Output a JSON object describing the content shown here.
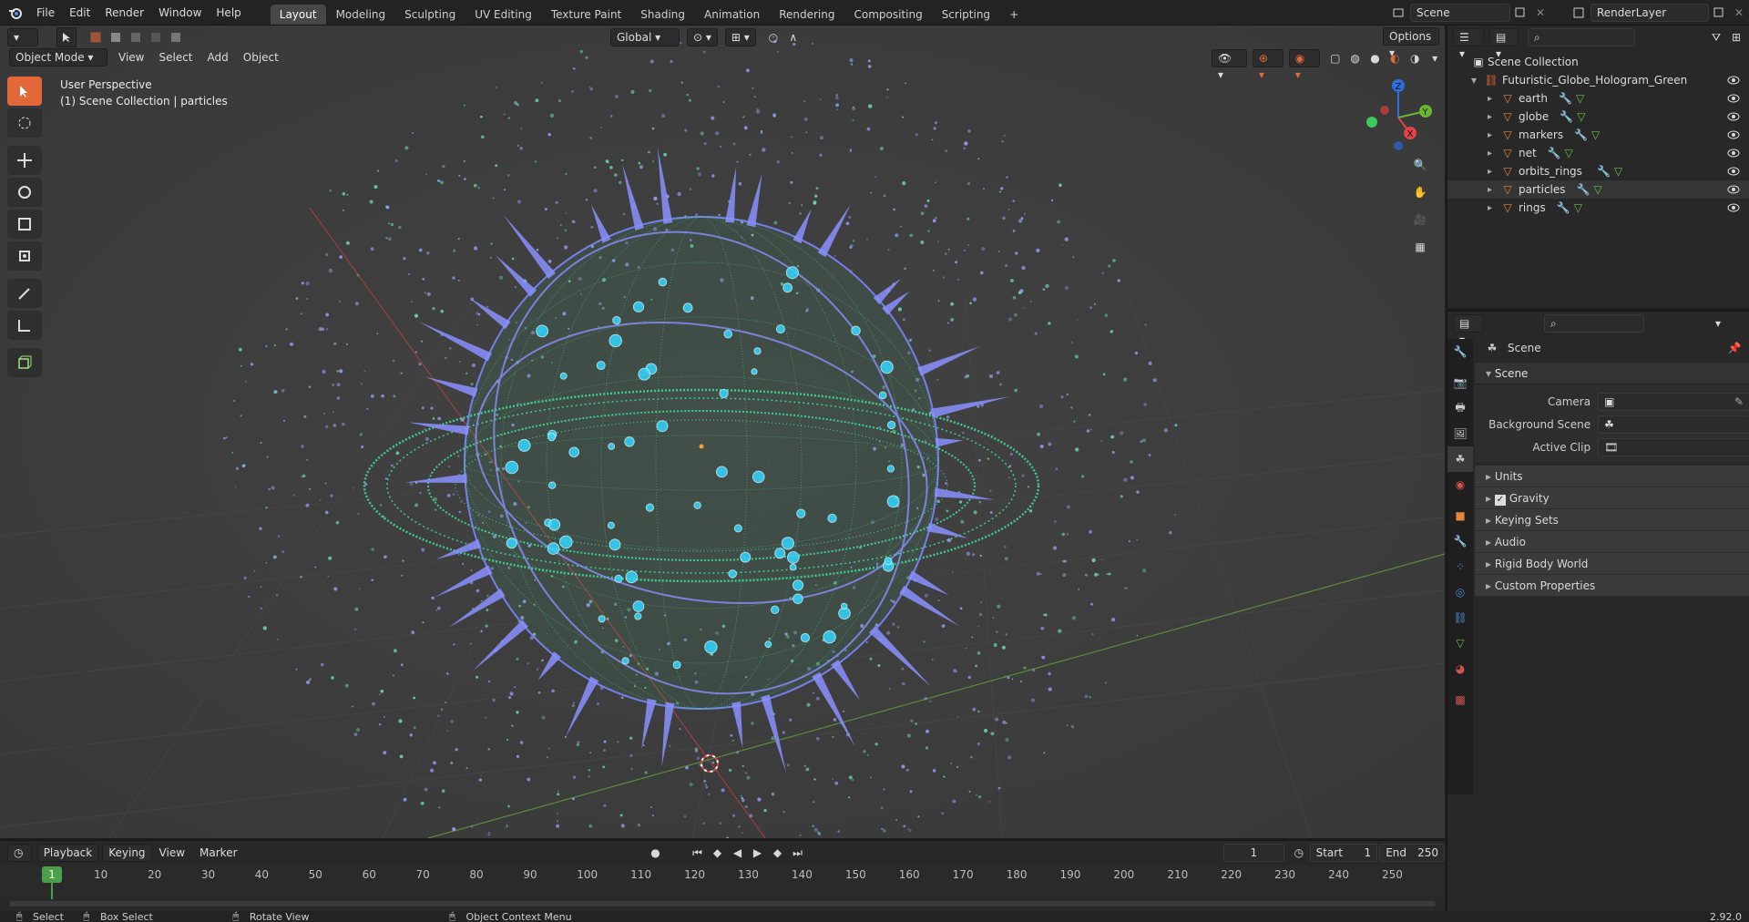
{
  "topbar": {
    "menus": [
      "File",
      "Edit",
      "Render",
      "Window",
      "Help"
    ],
    "workspaces": [
      "Layout",
      "Modeling",
      "Sculpting",
      "UV Editing",
      "Texture Paint",
      "Shading",
      "Animation",
      "Rendering",
      "Compositing",
      "Scripting"
    ],
    "active_workspace": "Layout",
    "add_tab": "+",
    "scene_name": "Scene",
    "view_layer": "RenderLayer"
  },
  "viewport": {
    "mode": "Object Mode",
    "menus": [
      "View",
      "Select",
      "Add",
      "Object"
    ],
    "orientation": "Global",
    "options_label": "Options",
    "overlay_title": "User Perspective",
    "overlay_subtitle": "(1) Scene Collection | particles",
    "gizmo": {
      "x": "X",
      "y": "Y",
      "z": "Z"
    }
  },
  "outliner": {
    "root": "Scene Collection",
    "collection": "Futuristic_Globe_Hologram_Green",
    "items": [
      {
        "name": "earth"
      },
      {
        "name": "globe"
      },
      {
        "name": "markers"
      },
      {
        "name": "net"
      },
      {
        "name": "orbits_rings"
      },
      {
        "name": "particles"
      },
      {
        "name": "rings"
      }
    ]
  },
  "properties": {
    "context": "Scene",
    "panel": "Scene",
    "fields": [
      {
        "label": "Camera",
        "value": ""
      },
      {
        "label": "Background Scene",
        "value": ""
      },
      {
        "label": "Active Clip",
        "value": ""
      }
    ],
    "subpanels": [
      "Units",
      "Gravity",
      "Keying Sets",
      "Audio",
      "Rigid Body World",
      "Custom Properties"
    ],
    "gravity_checked": true
  },
  "timeline": {
    "menus": [
      "Playback",
      "Keying",
      "View",
      "Marker"
    ],
    "current_frame": "1",
    "start_label": "Start",
    "start": "1",
    "end_label": "End",
    "end": "250",
    "ruler": [
      "10",
      "20",
      "30",
      "40",
      "50",
      "60",
      "70",
      "80",
      "90",
      "100",
      "110",
      "120",
      "130",
      "140",
      "150",
      "160",
      "170",
      "180",
      "190",
      "200",
      "210",
      "220",
      "230",
      "240",
      "250"
    ],
    "playhead": "1"
  },
  "statusbar": {
    "select": "Select",
    "box_select": "Box Select",
    "rotate": "Rotate View",
    "context_menu": "Object Context Menu",
    "version": "2.92.0"
  },
  "colors": {
    "accent": "#e2683a",
    "hologram_green": "#3fe39a",
    "hologram_blue": "#7a86ff",
    "hologram_cyan": "#33d6ff"
  }
}
